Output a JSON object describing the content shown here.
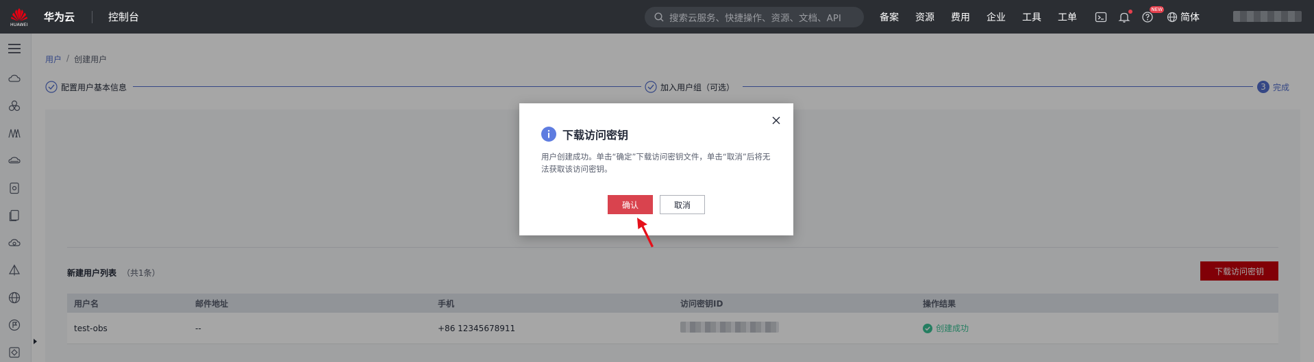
{
  "topbar": {
    "brand": "华为云",
    "logo_text": "HUAWEI",
    "console": "控制台",
    "search_placeholder": "搜索云服务、快捷操作、资源、文档、API",
    "nav": [
      "备案",
      "资源",
      "费用",
      "企业",
      "工具",
      "工单"
    ],
    "new_badge": "NEW",
    "language": "简体"
  },
  "breadcrumb": {
    "parent": "用户",
    "separator": "/",
    "current": "创建用户"
  },
  "steps": [
    {
      "label": "配置用户基本信息",
      "state": "done"
    },
    {
      "label": "加入用户组（可选）",
      "state": "done"
    },
    {
      "number": "3",
      "label": "完成",
      "state": "active"
    }
  ],
  "user_list": {
    "title": "新建用户列表",
    "count": "（共1条）",
    "download_button": "下载访问密钥",
    "columns": [
      "用户名",
      "邮件地址",
      "手机",
      "访问密钥ID",
      "操作结果"
    ],
    "rows": [
      {
        "username": "test-obs",
        "email": "--",
        "phone": "+86 12345678911",
        "result": "创建成功"
      }
    ]
  },
  "dialog": {
    "title": "下载访问密钥",
    "body": "用户创建成功。单击“确定”下载访问密钥文件，单击“取消”后将无法获取该访问密钥。",
    "confirm": "确认",
    "cancel": "取消"
  },
  "colors": {
    "topbar_bg": "#2b2e33",
    "accent_blue": "#526ecc",
    "brand_red": "#c7000b",
    "confirm_red": "#d9434e",
    "success_green": "#3ac295"
  }
}
